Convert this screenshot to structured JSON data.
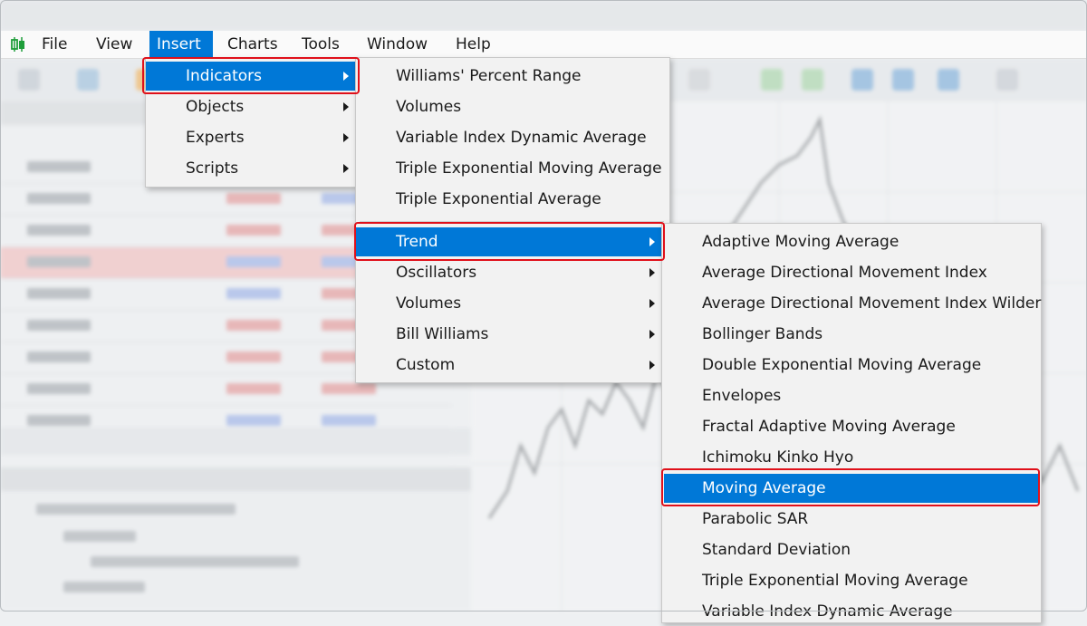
{
  "menubar": {
    "items": [
      {
        "label": "File"
      },
      {
        "label": "View"
      },
      {
        "label": "Insert"
      },
      {
        "label": "Charts"
      },
      {
        "label": "Tools"
      },
      {
        "label": "Window"
      },
      {
        "label": "Help"
      }
    ],
    "active": "Insert"
  },
  "insert_menu": {
    "items": [
      "Indicators",
      "Objects",
      "Experts",
      "Scripts"
    ],
    "highlighted": "Indicators"
  },
  "indicators_menu": {
    "items": [
      "Williams' Percent Range",
      "Volumes",
      "Variable Index Dynamic Average",
      "Triple Exponential Moving Average",
      "Triple Exponential Average"
    ],
    "submenus": [
      "Trend",
      "Oscillators",
      "Volumes",
      "Bill Williams",
      "Custom"
    ],
    "highlighted": "Trend"
  },
  "trend_menu": {
    "items": [
      "Adaptive Moving Average",
      "Average Directional Movement Index",
      "Average Directional Movement Index Wilder",
      "Bollinger Bands",
      "Double Exponential Moving Average",
      "Envelopes",
      "Fractal Adaptive Moving Average",
      "Ichimoku Kinko Hyo",
      "Moving Average",
      "Parabolic SAR",
      "Standard Deviation",
      "Triple Exponential Moving Average",
      "Variable Index Dynamic Average"
    ],
    "highlighted": "Moving Average"
  },
  "colors": {
    "highlight": "#0078d7",
    "callout": "#e0101a",
    "app_icon": "#1e9e3a"
  },
  "icons": {
    "app": "candlestick-chart-icon",
    "submenu": "chevron-right-icon"
  }
}
